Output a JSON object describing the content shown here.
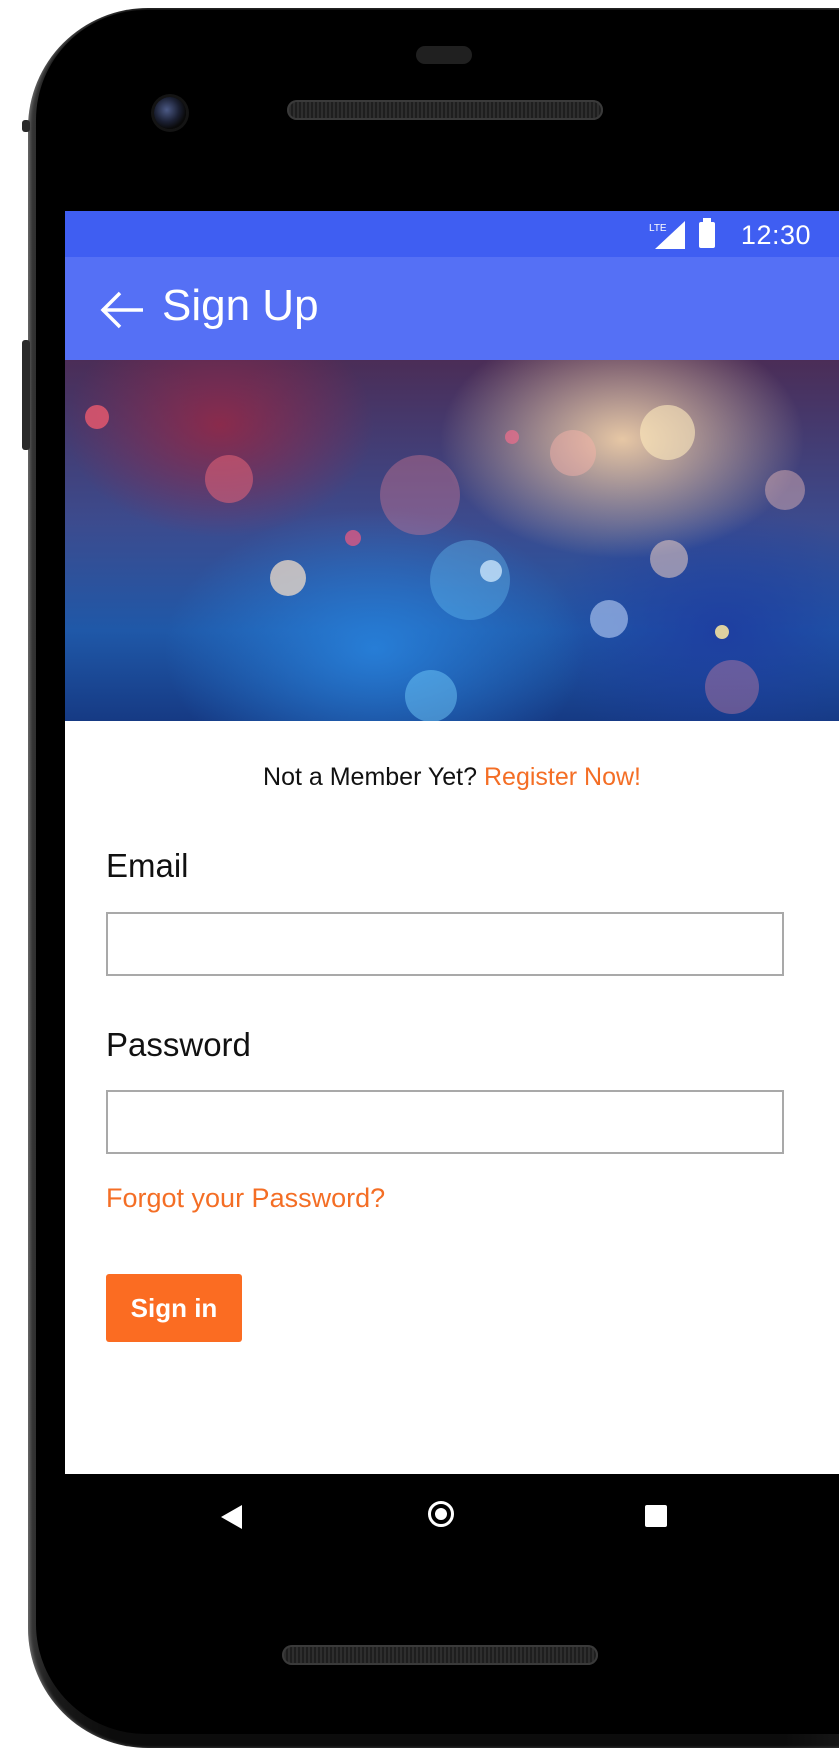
{
  "status_bar": {
    "network": "LTE",
    "time": "12:30"
  },
  "app_bar": {
    "title": "Sign Up",
    "back_icon": "arrow-back-icon"
  },
  "hero": {
    "image": "bokeh-lights-image"
  },
  "form": {
    "member_prompt": "Not a Member Yet?",
    "register_link": "Register Now!",
    "email_label": "Email",
    "email_value": "",
    "password_label": "Password",
    "password_value": "",
    "forgot_link": "Forgot your Password?",
    "signin_label": "Sign in"
  },
  "nav_bar": {
    "back": "triangle-back-icon",
    "home": "circle-home-icon",
    "recent": "square-recents-icon"
  },
  "colors": {
    "status_bar": "#3f5ef2",
    "app_bar": "#5570f5",
    "accent": "#f46e25",
    "button": "#fb6c22"
  }
}
